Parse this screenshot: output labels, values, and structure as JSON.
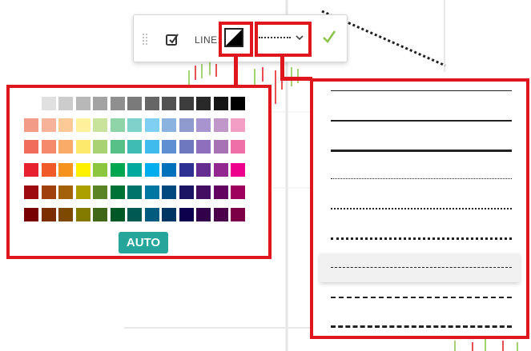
{
  "toolbar": {
    "grip_icon": "drag-grip-icon",
    "edit_icon": "edit-checkbox-icon",
    "line_label": "LINE:",
    "color_icon": "half-black-white-color-icon",
    "style_icon": "dotted-line-icon",
    "chevron_icon": "chevron-down-icon",
    "confirm_icon": "checkmark-icon",
    "confirm_color": "#8bc34a"
  },
  "highlight_color": "#e0161f",
  "palette": {
    "rows": [
      [
        "#ffffff",
        "#e0e0e0",
        "#cccccc",
        "#b8b8b8",
        "#a3a3a3",
        "#8f8f8f",
        "#7a7a7a",
        "#666666",
        "#525252",
        "#3d3d3d",
        "#292929",
        "#141414",
        "#000000"
      ],
      [
        "#f29b86",
        "#f7b29a",
        "#fcc997",
        "#fdf29b",
        "#c9e29c",
        "#8fd3a9",
        "#7fd1cc",
        "#7fcff2",
        "#8ab3e0",
        "#8f9bcf",
        "#a894cf",
        "#c196c9",
        "#f39fc5"
      ],
      [
        "#ef6d5a",
        "#f48a6b",
        "#f9ab67",
        "#fde96b",
        "#a9d272",
        "#56c088",
        "#3fbdb4",
        "#40bbee",
        "#5d8fd2",
        "#6d78bf",
        "#8e6fbd",
        "#a873b5",
        "#ef70a9"
      ],
      [
        "#e8212f",
        "#f05a28",
        "#f6921e",
        "#fff100",
        "#8cc63f",
        "#00a650",
        "#00a99d",
        "#00aeef",
        "#0072bc",
        "#2e3192",
        "#662d91",
        "#92278f",
        "#ec008c"
      ],
      [
        "#9e0b0f",
        "#a0410d",
        "#a3620a",
        "#aba000",
        "#598527",
        "#007236",
        "#00746b",
        "#0076a3",
        "#004a80",
        "#1b1464",
        "#440e62",
        "#630460",
        "#9e005d"
      ],
      [
        "#790000",
        "#7b2e00",
        "#7d4900",
        "#827b00",
        "#406618",
        "#005826",
        "#005952",
        "#005b7f",
        "#003663",
        "#0d004c",
        "#32004b",
        "#4b0049",
        "#7b0046"
      ]
    ],
    "auto_label": "AUTO"
  },
  "line_styles": [
    {
      "name": "solid-thin",
      "style": "solid",
      "width": 1
    },
    {
      "name": "solid-medium",
      "style": "solid",
      "width": 2
    },
    {
      "name": "solid-thick",
      "style": "solid",
      "width": 3
    },
    {
      "name": "dotted-thin",
      "style": "dotted",
      "width": 1
    },
    {
      "name": "dotted-medium",
      "style": "dotted",
      "width": 2
    },
    {
      "name": "dotted-thick",
      "style": "dotted",
      "width": 3
    },
    {
      "name": "dashed-thin",
      "style": "dashed",
      "width": 1,
      "selected": true
    },
    {
      "name": "dashed-medium",
      "style": "dashed",
      "width": 2
    },
    {
      "name": "dashed-thick",
      "style": "dashed",
      "width": 3
    }
  ]
}
